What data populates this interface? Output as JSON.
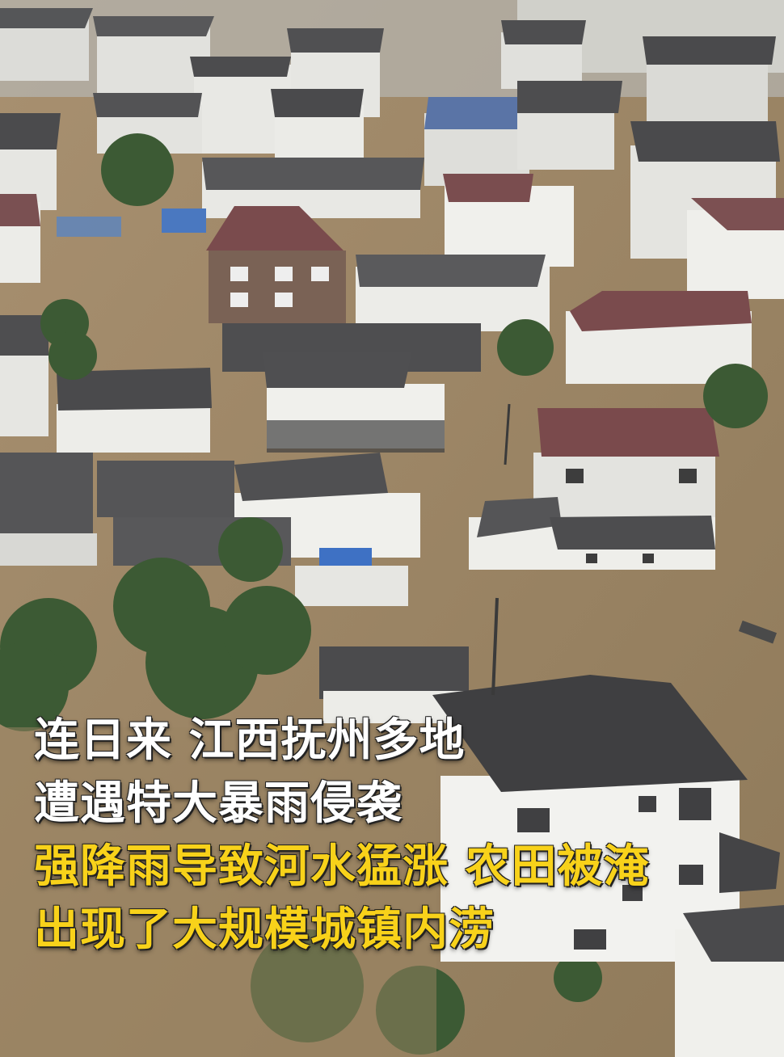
{
  "scene": {
    "subject": "flooded-village",
    "colors": {
      "water": "#9c8766",
      "water_light": "#b09a78",
      "wall": "#e8e8e6",
      "roof_dark": "#4a4a4c",
      "roof_red": "#7a4a4c",
      "roof_blue": "#4a6fa8",
      "tree": "#3f5e36",
      "mist": "#cfd2d0"
    }
  },
  "caption": {
    "line1": "连日来 江西抚州多地",
    "line2": "遭遇特大暴雨侵袭",
    "line3": "强降雨导致河水猛涨 农田被淹",
    "line4": "出现了大规模城镇内涝"
  }
}
